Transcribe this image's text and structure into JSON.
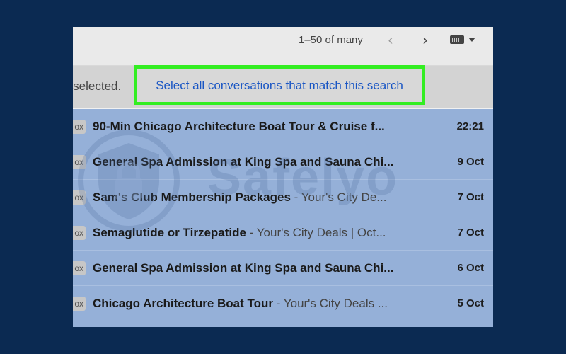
{
  "toolbar": {
    "pager_text": "1–50 of many",
    "prev_icon": "chevron-left-icon",
    "next_icon": "chevron-right-icon",
    "keyboard_icon": "keyboard-icon"
  },
  "selection_bar": {
    "selected_text": "e selected.",
    "select_all_link": "Select all conversations that match this search",
    "highlight_color": "#33ee22",
    "link_color": "#1a56c4"
  },
  "emails": [
    {
      "tag": "ox",
      "subject": "90-Min Chicago Architecture Boat Tour & Cruise f...",
      "snippet": "",
      "date": "22:21"
    },
    {
      "tag": "ox",
      "subject": "General Spa Admission at King Spa and Sauna Chi...",
      "snippet": "",
      "date": "9 Oct"
    },
    {
      "tag": "ox",
      "subject": "Sam's Club Membership Packages",
      "snippet": " - Your's City De...",
      "date": "7 Oct"
    },
    {
      "tag": "ox",
      "subject": "Semaglutide or Tirzepatide",
      "snippet": " - Your's City Deals | Oct...",
      "date": "7 Oct"
    },
    {
      "tag": "ox",
      "subject": "General Spa Admission at King Spa and Sauna Chi...",
      "snippet": "",
      "date": "6 Oct"
    },
    {
      "tag": "ox",
      "subject": "Chicago Architecture Boat Tour",
      "snippet": " - Your's City Deals ...",
      "date": "5 Oct"
    }
  ],
  "watermark": {
    "text": "Safelyo",
    "icon": "shield-lock-icon"
  },
  "colors": {
    "background": "#0b2a52",
    "selected_row": "#95b0d8"
  }
}
